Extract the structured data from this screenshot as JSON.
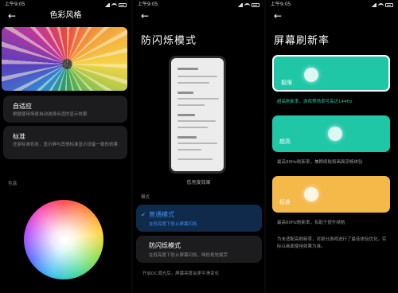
{
  "status": {
    "time": "上午9:05"
  },
  "color_style": {
    "title": "色彩风格",
    "options": [
      {
        "title": "自适应",
        "desc": "根据使用场景自动选择合适的显示效果"
      },
      {
        "title": "标准",
        "desc": "还原标准色彩，显示屏与其他标准显示设备一致的效果"
      }
    ],
    "temp_label": "色温"
  },
  "flicker": {
    "title": "防闪烁模式",
    "preview_caption": "低亮度效果",
    "mode_label": "模式",
    "options": [
      {
        "title": "普通模式",
        "desc": "在低亮度下防止屏幕闪烁",
        "selected": true
      },
      {
        "title": "防闪烁模式",
        "desc": "在低亮度下防止屏幕闪烁，降低视觉疲劳",
        "selected": false
      }
    ],
    "footnote": "开启DC调光后，屏幕亮度会更平滑变化"
  },
  "refresh": {
    "title": "屏幕刷新率",
    "options": [
      {
        "label": "极限",
        "desc": "超高刷新率，游戏等场景可高达144Hz",
        "color": "#1fc7a6",
        "selected": true
      },
      {
        "label": "超高",
        "desc": "最高90Hz刷新率，兼顾续航和画面流畅体验",
        "color": "#1fc7a6",
        "selected": false
      },
      {
        "label": "标准",
        "desc": "最高60Hz刷新率，有助于提升续航",
        "color": "#f5b94a",
        "selected": false
      }
    ],
    "note": "为未适配高刷新率，对部分游戏进行了最佳体验优化，实际以画面使用效果为准。"
  },
  "icons": {
    "back": "arrow-left-icon",
    "check": "check-icon",
    "signal": "signal-icon",
    "wifi": "wifi-icon",
    "battery": "battery-icon"
  }
}
